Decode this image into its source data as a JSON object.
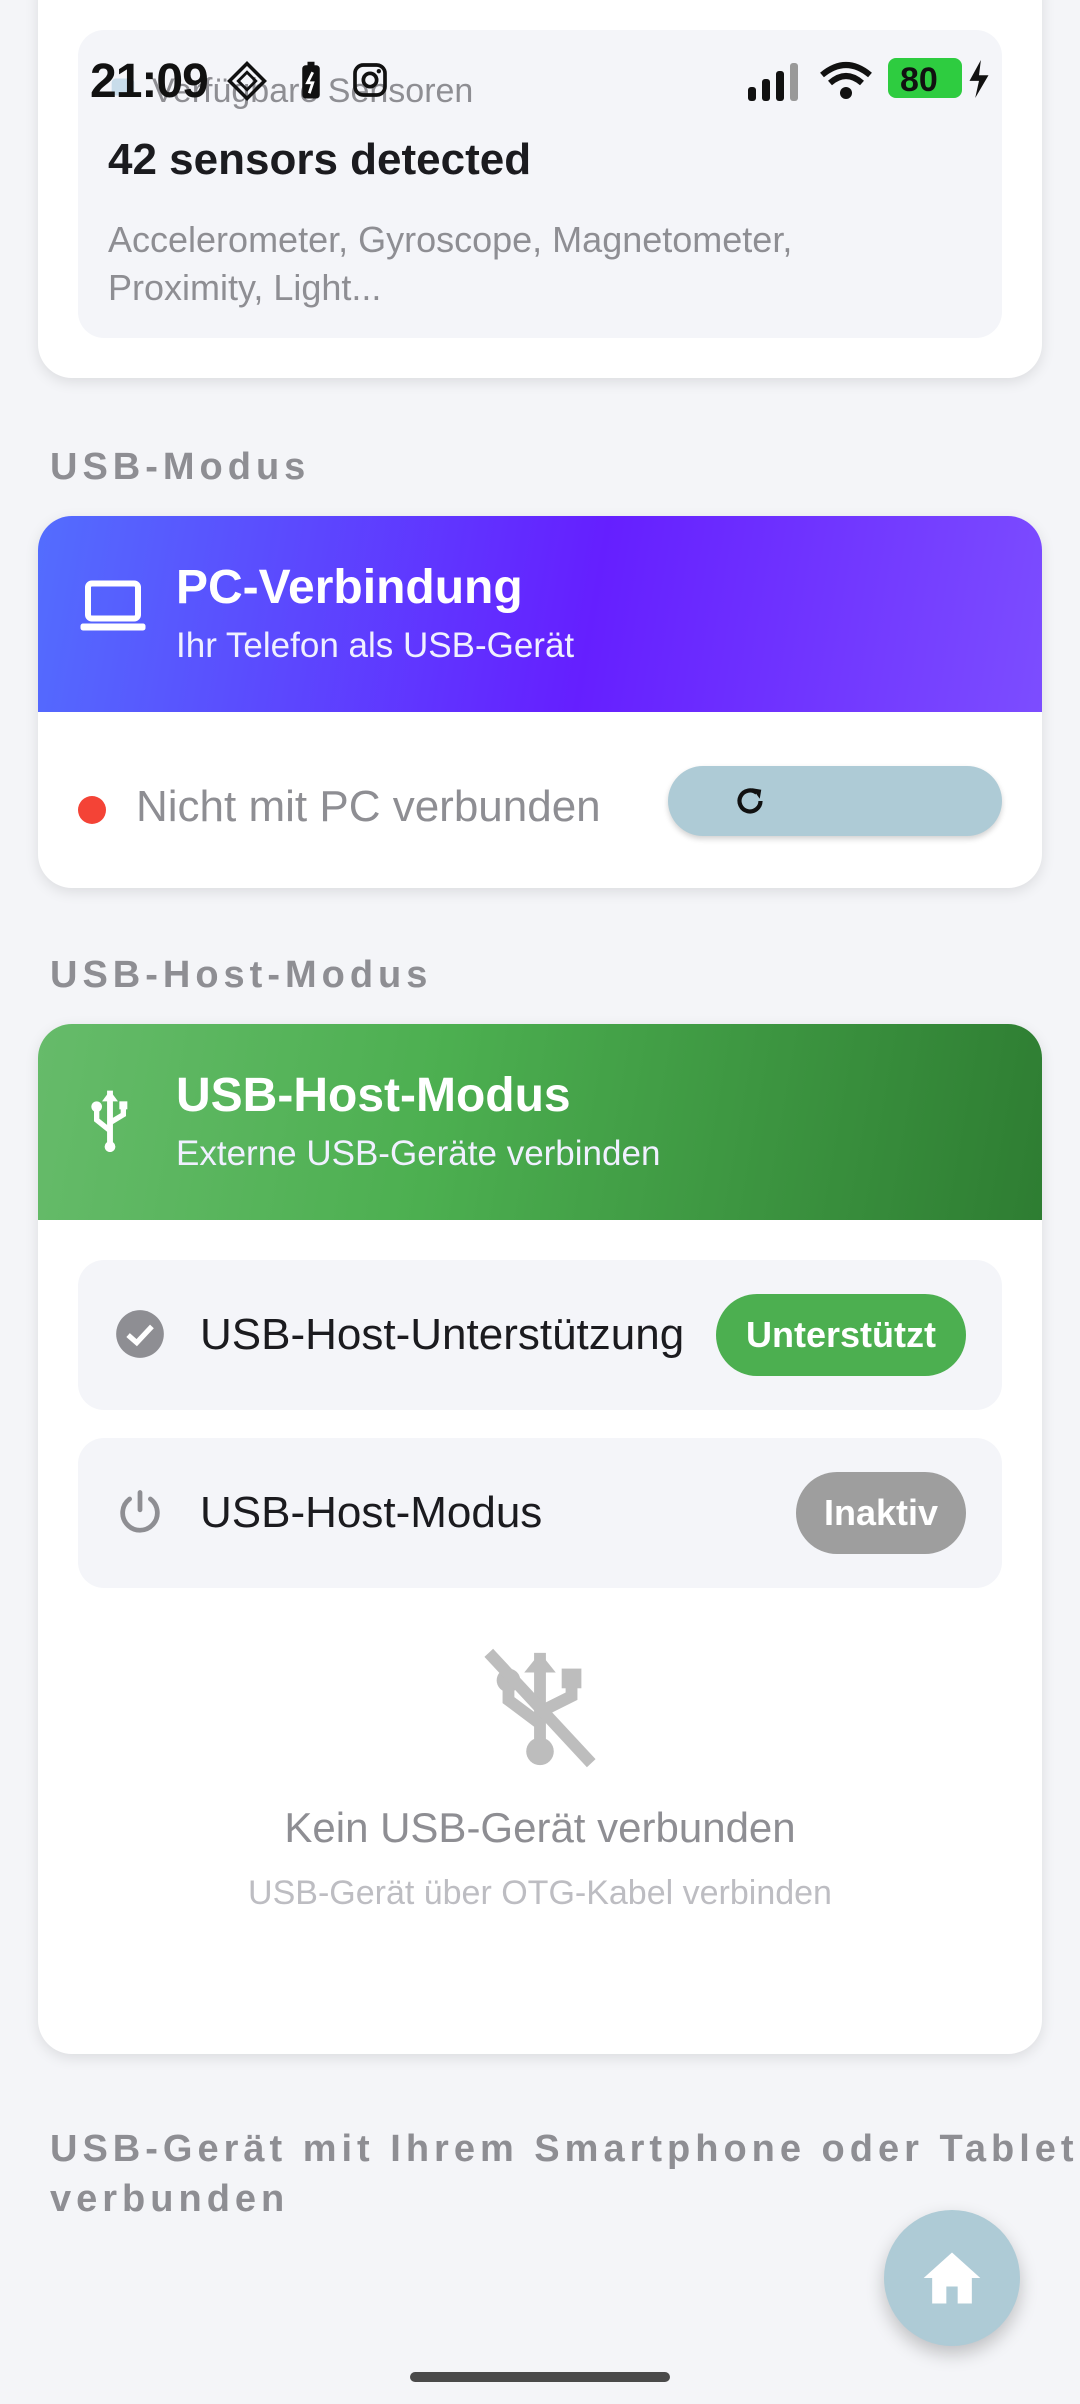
{
  "status_bar": {
    "time": "21:09",
    "battery": "80"
  },
  "sensors": {
    "header_label": "Verfügbare Sensoren",
    "title": "42 sensors detected",
    "description": "Accelerometer, Gyroscope, Magnetometer, Proximity, Light..."
  },
  "usb_mode": {
    "section_title": "USB-Modus",
    "card_title": "PC-Verbindung",
    "card_subtitle": "Ihr Telefon als USB-Gerät",
    "status_text": "Nicht mit PC verbunden",
    "icon": "laptop-icon",
    "refresh_icon": "refresh-icon"
  },
  "usb_host": {
    "section_title": "USB-Host-Modus",
    "card_title": "USB-Host-Modus",
    "card_subtitle": "Externe USB-Geräte verbinden",
    "support_label": "USB-Host-Unterstützung",
    "support_badge": "Unterstützt",
    "mode_label": "USB-Host-Modus",
    "mode_badge": "Inaktiv",
    "empty_title": "Kein USB-Gerät verbunden",
    "empty_subtitle": "USB-Gerät über OTG-Kabel verbinden"
  },
  "footer": {
    "text_line1": "USB-Gerät mit Ihrem Smartphone oder Tablet",
    "text_line2": "verbunden"
  },
  "colors": {
    "pc_gradient": [
      "#536dfe",
      "#651fff",
      "#7c4dff"
    ],
    "host_gradient": [
      "#66bb6a",
      "#2e7d32"
    ],
    "accent_button": "#aecbd6",
    "status_red": "#f44336",
    "badge_green": "#4caf50",
    "badge_gray": "#9e9e9e"
  }
}
